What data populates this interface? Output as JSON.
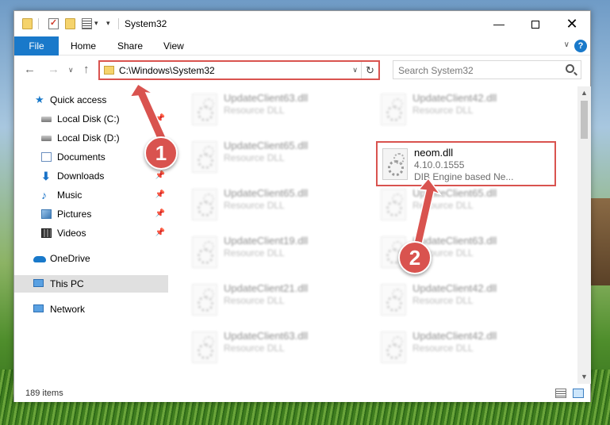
{
  "window": {
    "title": "System32",
    "minimize_label": "—",
    "close_label": "✕"
  },
  "ribbon": {
    "tabs": [
      "File",
      "Home",
      "Share",
      "View"
    ],
    "help_label": "?"
  },
  "navbar": {
    "address": "C:\\Windows\\System32",
    "search_placeholder": "Search System32"
  },
  "sidebar": {
    "items": [
      {
        "label": "Quick access",
        "icon": "star-icon"
      },
      {
        "label": "Local Disk (C:)",
        "icon": "disk-icon",
        "pinned": true
      },
      {
        "label": "Local Disk (D:)",
        "icon": "disk-icon",
        "pinned": true
      },
      {
        "label": "Documents",
        "icon": "documents-icon",
        "pinned": true
      },
      {
        "label": "Downloads",
        "icon": "download-icon",
        "pinned": true
      },
      {
        "label": "Music",
        "icon": "music-icon",
        "pinned": true
      },
      {
        "label": "Pictures",
        "icon": "pictures-icon",
        "pinned": true
      },
      {
        "label": "Videos",
        "icon": "videos-icon",
        "pinned": true
      },
      {
        "label": "OneDrive",
        "icon": "cloud-icon"
      },
      {
        "label": "This PC",
        "icon": "computer-icon",
        "selected": true
      },
      {
        "label": "Network",
        "icon": "network-icon"
      }
    ]
  },
  "files": {
    "left_column": [
      {
        "name": "UpdateClient63.dll",
        "type": "Resource DLL"
      },
      {
        "name": "UpdateClient65.dll",
        "type": "Resource DLL"
      },
      {
        "name": "UpdateClient65.dll",
        "type": "Resource DLL"
      },
      {
        "name": "UpdateClient19.dll",
        "type": "Resource DLL"
      },
      {
        "name": "UpdateClient21.dll",
        "type": "Resource DLL"
      },
      {
        "name": "UpdateClient63.dll",
        "type": "Resource DLL"
      }
    ],
    "right_column": [
      {
        "name": "UpdateClient42.dll",
        "type": "Resource DLL"
      },
      {
        "name": "UpdateClient65.dll",
        "type": "Resource DLL"
      },
      {
        "name": "UpdateClient63.dll",
        "type": "Resource DLL"
      },
      {
        "name": "UpdateClient42.dll",
        "type": "Resource DLL"
      },
      {
        "name": "UpdateClient42.dll",
        "type": "Resource DLL"
      }
    ],
    "highlighted": {
      "name": "neom.dll",
      "version": "4.10.0.1555",
      "description": "DIB Engine based Ne..."
    }
  },
  "status": {
    "item_count": "189 items"
  },
  "annotations": {
    "step1": "1",
    "step2": "2",
    "color": "#d9534f"
  }
}
